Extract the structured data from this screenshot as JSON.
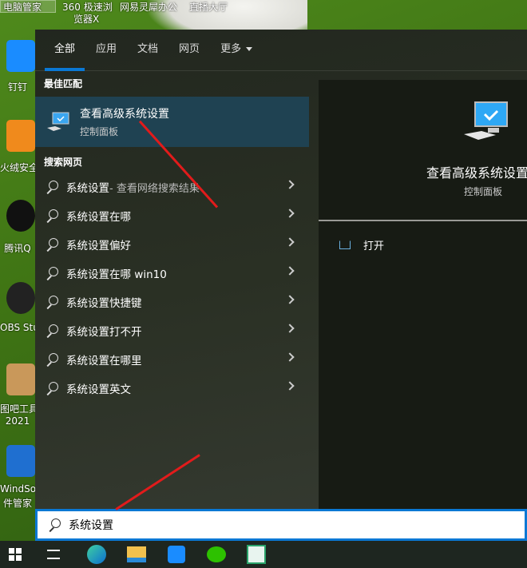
{
  "desktop": {
    "top_labels": [
      "电脑管家",
      "360 极速浏",
      "览器X",
      "网易灵犀办公",
      "直播大厅"
    ],
    "icons": [
      {
        "label": "钉钉",
        "color": "#1a8cff"
      },
      {
        "label": "火绒安全",
        "color": "#f08a1c"
      },
      {
        "label": "腾讯Q",
        "color": "#111111"
      },
      {
        "label": "OBS Stu",
        "color": "#222222"
      },
      {
        "label": "图吧工具",
        "label2": "2021",
        "color": "#c9985a"
      },
      {
        "label": "WindSo",
        "label2": "件管家",
        "color": "#1f6fd0"
      }
    ]
  },
  "search_panel": {
    "tabs": [
      {
        "label": "全部",
        "active": true
      },
      {
        "label": "应用"
      },
      {
        "label": "文档"
      },
      {
        "label": "网页"
      },
      {
        "label": "更多"
      }
    ],
    "best_match_heading": "最佳匹配",
    "best_match": {
      "title": "查看高级系统设置",
      "subtitle": "控制面板"
    },
    "web_heading": "搜索网页",
    "web_results": [
      {
        "text": "系统设置",
        "suffix": " - 查看网络搜索结果"
      },
      {
        "text": "系统设置在哪"
      },
      {
        "text": "系统设置偏好"
      },
      {
        "text": "系统设置在哪 win10"
      },
      {
        "text": "系统设置快捷键"
      },
      {
        "text": "系统设置打不开"
      },
      {
        "text": "系统设置在哪里"
      },
      {
        "text": "系统设置英文"
      }
    ],
    "preview": {
      "title": "查看高级系统设置",
      "subtitle": "控制面板",
      "open_label": "打开"
    }
  },
  "search_box": {
    "value": "系统设置"
  },
  "taskbar": {
    "items": [
      "start-icon",
      "task-view-icon",
      "edge-icon",
      "file-explorer-icon",
      "dingtalk-icon",
      "wechat-icon",
      "app-icon"
    ]
  },
  "colors": {
    "accent": "#0a78d4",
    "annotation_arrow": "#e21b1b",
    "selection": "#1f4252"
  }
}
